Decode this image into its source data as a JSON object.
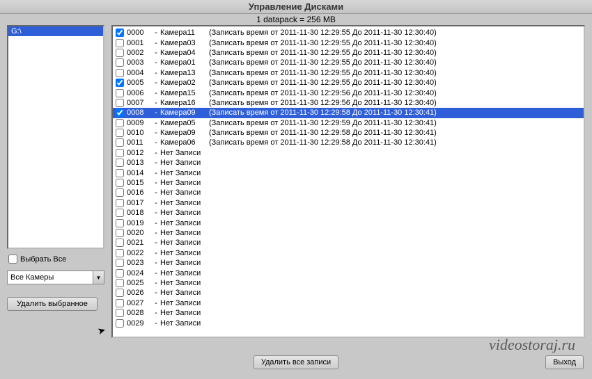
{
  "title": "Управление Дисками",
  "info_line": "1 datapack = 256 MB",
  "watermark": "videostoraj.ru",
  "drive": {
    "items": [
      "G:\\"
    ],
    "selected_index": 0
  },
  "select_all": {
    "label": "Выбрать Все",
    "checked": false
  },
  "camera_filter": {
    "selected": "Все Камеры"
  },
  "buttons": {
    "delete_selected": "Удалить выбранное",
    "delete_all": "Удалить все записи",
    "exit": "Выход"
  },
  "selected_record_index": 8,
  "records": [
    {
      "checked": true,
      "id": "0000",
      "camera": "Камера11",
      "info": "(Записать время от 2011-11-30 12:29:55 До 2011-11-30 12:30:40)"
    },
    {
      "checked": false,
      "id": "0001",
      "camera": "Камера03",
      "info": "(Записать время от 2011-11-30 12:29:55 До 2011-11-30 12:30:40)"
    },
    {
      "checked": false,
      "id": "0002",
      "camera": "Камера04",
      "info": "(Записать время от 2011-11-30 12:29:55 До 2011-11-30 12:30:40)"
    },
    {
      "checked": false,
      "id": "0003",
      "camera": "Камера01",
      "info": "(Записать время от 2011-11-30 12:29:55 До 2011-11-30 12:30:40)"
    },
    {
      "checked": false,
      "id": "0004",
      "camera": "Камера13",
      "info": "(Записать время от 2011-11-30 12:29:55 До 2011-11-30 12:30:40)"
    },
    {
      "checked": true,
      "id": "0005",
      "camera": "Камера02",
      "info": "(Записать время от 2011-11-30 12:29:55 До 2011-11-30 12:30:40)"
    },
    {
      "checked": false,
      "id": "0006",
      "camera": "Камера15",
      "info": "(Записать время от 2011-11-30 12:29:56 До 2011-11-30 12:30:40)"
    },
    {
      "checked": false,
      "id": "0007",
      "camera": "Камера16",
      "info": "(Записать время от 2011-11-30 12:29:56 До 2011-11-30 12:30:40)"
    },
    {
      "checked": true,
      "id": "0008",
      "camera": "Камера09",
      "info": "(Записать время от 2011-11-30 12:29:58 До 2011-11-30 12:30:41)"
    },
    {
      "checked": false,
      "id": "0009",
      "camera": "Камера05",
      "info": "(Записать время от 2011-11-30 12:29:59 До 2011-11-30 12:30:41)"
    },
    {
      "checked": false,
      "id": "0010",
      "camera": "Камера09",
      "info": "(Записать время от 2011-11-30 12:29:58 До 2011-11-30 12:30:41)"
    },
    {
      "checked": false,
      "id": "0011",
      "camera": "Камера06",
      "info": "(Записать время от 2011-11-30 12:29:58 До 2011-11-30 12:30:41)"
    },
    {
      "checked": false,
      "id": "0012",
      "camera": "Нет Записи",
      "info": ""
    },
    {
      "checked": false,
      "id": "0013",
      "camera": "Нет Записи",
      "info": ""
    },
    {
      "checked": false,
      "id": "0014",
      "camera": "Нет Записи",
      "info": ""
    },
    {
      "checked": false,
      "id": "0015",
      "camera": "Нет Записи",
      "info": ""
    },
    {
      "checked": false,
      "id": "0016",
      "camera": "Нет Записи",
      "info": ""
    },
    {
      "checked": false,
      "id": "0017",
      "camera": "Нет Записи",
      "info": ""
    },
    {
      "checked": false,
      "id": "0018",
      "camera": "Нет Записи",
      "info": ""
    },
    {
      "checked": false,
      "id": "0019",
      "camera": "Нет Записи",
      "info": ""
    },
    {
      "checked": false,
      "id": "0020",
      "camera": "Нет Записи",
      "info": ""
    },
    {
      "checked": false,
      "id": "0021",
      "camera": "Нет Записи",
      "info": ""
    },
    {
      "checked": false,
      "id": "0022",
      "camera": "Нет Записи",
      "info": ""
    },
    {
      "checked": false,
      "id": "0023",
      "camera": "Нет Записи",
      "info": ""
    },
    {
      "checked": false,
      "id": "0024",
      "camera": "Нет Записи",
      "info": ""
    },
    {
      "checked": false,
      "id": "0025",
      "camera": "Нет Записи",
      "info": ""
    },
    {
      "checked": false,
      "id": "0026",
      "camera": "Нет Записи",
      "info": ""
    },
    {
      "checked": false,
      "id": "0027",
      "camera": "Нет Записи",
      "info": ""
    },
    {
      "checked": false,
      "id": "0028",
      "camera": "Нет Записи",
      "info": ""
    },
    {
      "checked": false,
      "id": "0029",
      "camera": "Нет Записи",
      "info": ""
    }
  ]
}
